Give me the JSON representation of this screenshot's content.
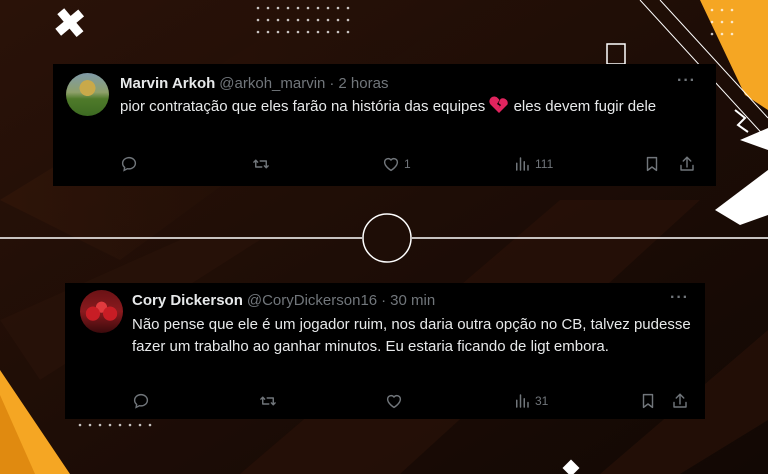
{
  "colors": {
    "background": "#1a0c06",
    "tweet_bg": "#000000",
    "text_primary": "#e7e9ea",
    "text_secondary": "#71767b",
    "accent_yellow": "#f5a623"
  },
  "tweets": [
    {
      "display_name": "Marvin Arkoh",
      "handle": "@arkoh_marvin",
      "separator": "·",
      "time": "2 horas",
      "more": "···",
      "text_before": "pior contratação que eles farão na história das equipes ",
      "emoji": "broken-heart",
      "text_after": " eles devem fugir dele",
      "replies": "",
      "retweets": "",
      "likes": "1",
      "views": "111"
    },
    {
      "display_name": "Cory Dickerson",
      "handle": "@CoryDickerson16",
      "separator": "·",
      "time": "30 min",
      "more": "···",
      "text": "Não pense que ele é um jogador ruim, nos daria outra opção no CB, talvez pudesse fazer um trabalho ao ganhar minutos. Eu estaria ficando de ligt embora.",
      "replies": "",
      "retweets": "",
      "likes": "",
      "views": "31"
    }
  ]
}
